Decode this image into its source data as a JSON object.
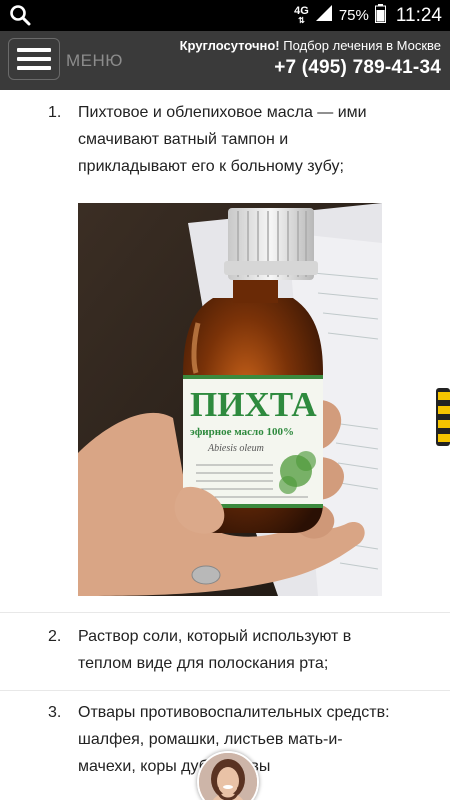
{
  "status_bar": {
    "network": "4G",
    "battery": "75%",
    "time": "11:24",
    "icons": [
      "search-icon",
      "signal-icon",
      "battery-icon"
    ]
  },
  "header": {
    "menu_label": "МЕНЮ",
    "promo_bold": "Круглосуточно!",
    "promo_rest": " Подбор лечения в Москве",
    "phone": "+7 (495) 789-41-34"
  },
  "list": [
    {
      "number": "1.",
      "text": "Пихтовое и облепиховое масла — ими смачивают ватный тампон и прикладывают его к больному зубу;"
    },
    {
      "number": "2.",
      "text": "Раствор соли, который используют в теплом виде для полоскания рта;"
    },
    {
      "number": "3.",
      "text": "Отвары противовоспалительных средств: шалфея, ромашки, листьев мать-и-мачехи, коры дуба, травы"
    }
  ],
  "photo": {
    "bottle_label_big": "ПИХТА",
    "bottle_label_small": "эфирное масло 100%",
    "bottle_label_latin": "Abiesis oleum"
  },
  "colors": {
    "header_bg": "#3a3a3a",
    "status_bg": "#000000",
    "label_green": "#2e8a3e"
  }
}
